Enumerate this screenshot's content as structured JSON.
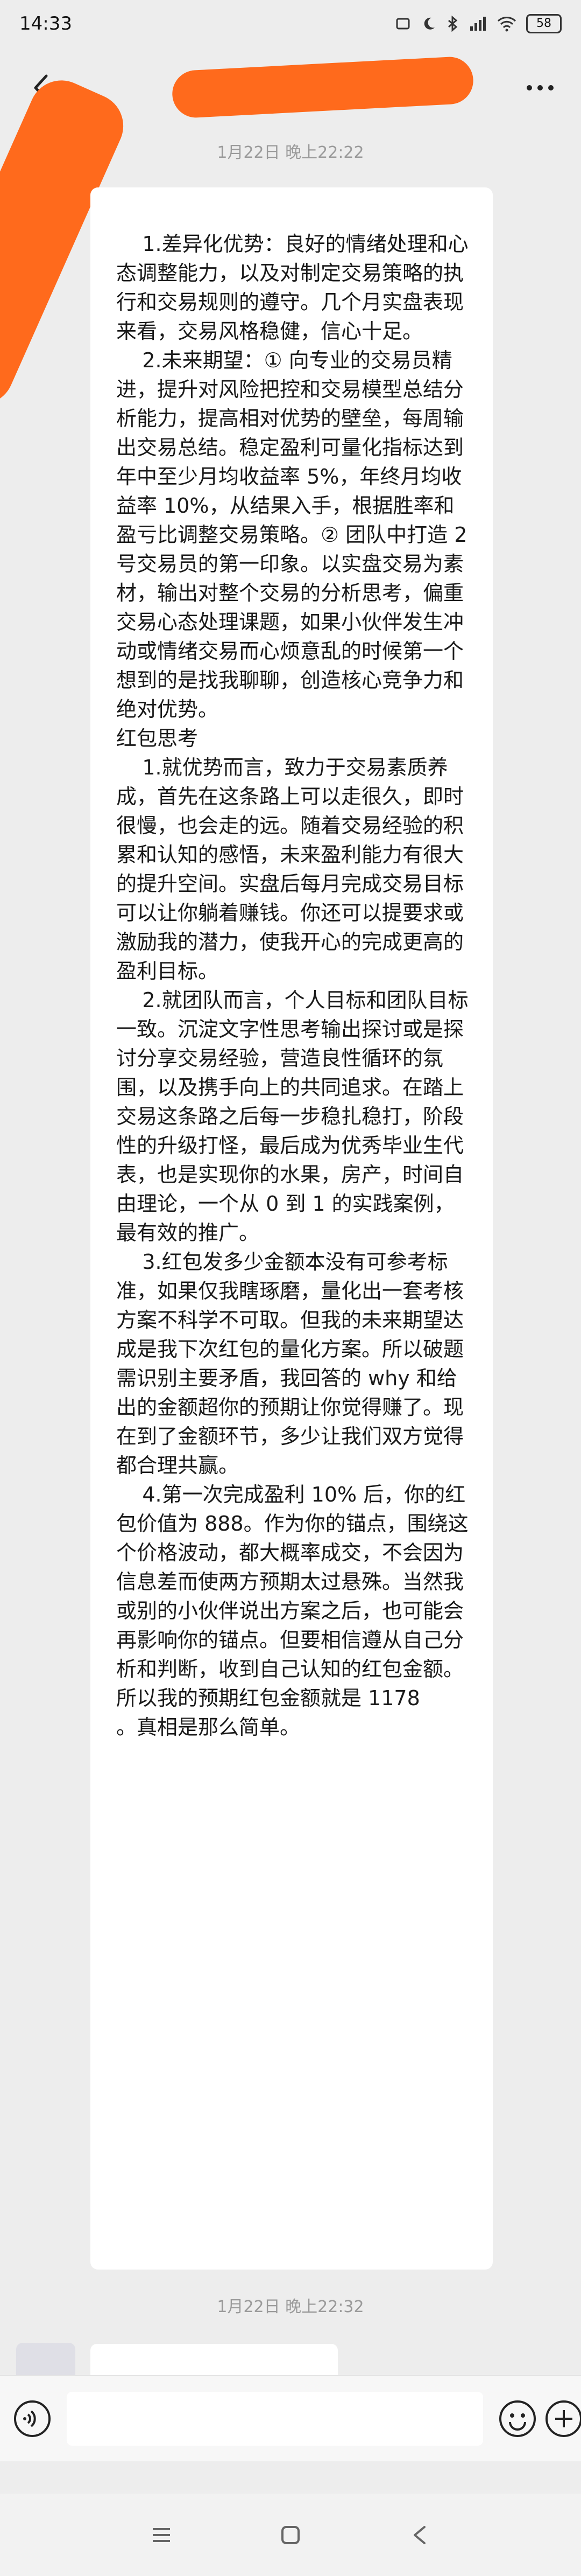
{
  "status_bar": {
    "time": "14:33",
    "icons": [
      "mi-icon",
      "notification-icon",
      "moon-icon",
      "bluetooth-icon",
      "hd-signal-icon",
      "signal-icon",
      "wifi-icon"
    ],
    "battery": "58"
  },
  "header": {
    "back_icon": "chevron-left-icon",
    "more_icon": "more-dots-icon"
  },
  "messages": {
    "timestamp_1": "1月22日 晚上22:22",
    "body": "    1.差异化优势：良好的情绪处理和心态调整能力，以及对制定交易策略的执行和交易规则的遵守。几个月实盘表现来看，交易风格稳健，信心十足。\n    2.未来期望：① 向专业的交易员精进，提升对风险把控和交易模型总结分析能力，提高相对优势的壁垒，每周输出交易总结。稳定盈利可量化指标达到年中至少月均收益率 5%，年终月均收益率 10%，从结果入手，根据胜率和盈亏比调整交易策略。② 团队中打造 2 号交易员的第一印象。以实盘交易为素材，输出对整个交易的分析思考，偏重交易心态处理课题，如果小伙伴发生冲动或情绪交易而心烦意乱的时候第一个想到的是找我聊聊，创造核心竞争力和绝对优势。\n红包思考\n    1.就优势而言，致力于交易素质养成，首先在这条路上可以走很久，即时很慢，也会走的远。随着交易经验的积累和认知的感悟，未来盈利能力有很大的提升空间。实盘后每月完成交易目标可以让你躺着赚钱。你还可以提要求或激励我的潜力，使我开心的完成更高的盈利目标。\n    2.就团队而言，个人目标和团队目标一致。沉淀文字性思考输出探讨或是探讨分享交易经验，营造良性循环的氛围，以及携手向上的共同追求。在踏上交易这条路之后每一步稳扎稳打，阶段性的升级打怪，最后成为优秀毕业生代表，也是实现你的水果，房产，时间自由理论，一个从 0 到 1 的实践案例，最有效的推广。\n    3.红包发多少金额本没有可参考标准，如果仅我瞎琢磨，量化出一套考核方案不科学不可取。但我的未来期望达成是我下次红包的量化方案。所以破题需识别主要矛盾，我回答的 why 和给出的金额超你的预期让你觉得赚了。现在到了金额环节，多少让我们双方觉得都合理共赢。\n    4.第一次完成盈利 10% 后，你的红包价值为 888。作为你的锚点，围绕这个价格波动，都大概率成交，不会因为信息差而使两方预期太过悬殊。当然我或别的小伙伴说出方案之后，也可能会再影响你的锚点。但要相信遵从自己分析和判断，收到自己认知的红包金额。所以我的预期红包金额就是 1178\n。真相是那么简单。",
    "timestamp_2": "1月22日 晚上22:32"
  },
  "input_bar": {
    "voice_icon": "voice-icon",
    "emoji_icon": "emoji-icon",
    "add_icon": "plus-circle-icon"
  },
  "system_nav": {
    "menu_icon": "menu-icon",
    "home_icon": "home-square-icon",
    "back_icon": "back-triangle-icon"
  },
  "colors": {
    "background": "#ededed",
    "bubble": "#ffffff",
    "redaction": "#ff6a1c",
    "timestamp": "#9a9a9a"
  }
}
